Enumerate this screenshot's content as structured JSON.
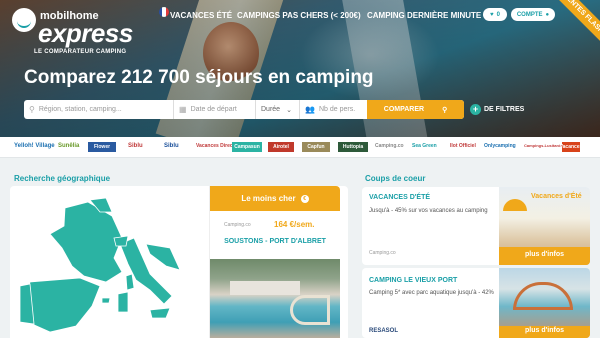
{
  "header": {
    "logo_top": "mobilhome",
    "logo_main": "express",
    "logo_tagline": "LE COMPARATEUR CAMPING",
    "language_flag": "flag-fr-icon",
    "nav": [
      "VACANCES ÉTÉ",
      "CAMPINGS PAS CHERS (< 200€)",
      "CAMPING DERNIÈRE MINUTE"
    ],
    "favorites_count": "0",
    "account_label": "COMPTE",
    "ribbon": "VENTES FLASH"
  },
  "hero": {
    "headline": "Comparez 212 700 séjours en camping"
  },
  "search": {
    "destination_placeholder": "Région, station, camping...",
    "date_placeholder": "Date de départ",
    "duration_value": "Durée",
    "persons_placeholder": "Nb de pers.",
    "button_label": "COMPARER",
    "filters_label": "DE FILTRES"
  },
  "brands": [
    "Yelloh! Village",
    "Sunêlia",
    "Flower",
    "Siblu",
    "Vacances Directes",
    "Campasun",
    "Airotel",
    "Capfun",
    "Huttopia",
    "Camping.co",
    "Sea Green",
    "Ilot Officiel",
    "Onlycamping",
    "Campings-Lusitania",
    "Vacances"
  ],
  "geo": {
    "title": "Recherche géographique"
  },
  "promo": {
    "label": "Le moins cher",
    "source": "Camping.co",
    "price": "164 €/sem.",
    "name": "SOUSTONS - PORT D'ALBRET"
  },
  "deals": {
    "title": "Coups de coeur",
    "items": [
      {
        "title": "VACANCES D'ÉTÉ",
        "text": "Jusqu'à - 45% sur vos vacances au camping",
        "source": "Camping.co",
        "image_caption": "Vacances d'Été",
        "link": "plus d'infos"
      },
      {
        "title": "CAMPING LE VIEUX PORT",
        "text": "Camping 5* avec parc aquatique jusqu'à - 42%",
        "source": "RESASOL",
        "link": "plus d'infos"
      }
    ]
  },
  "colors": {
    "teal": "#1a9fa7",
    "orange": "#f0a81a",
    "map_green": "#2bb3a3"
  }
}
